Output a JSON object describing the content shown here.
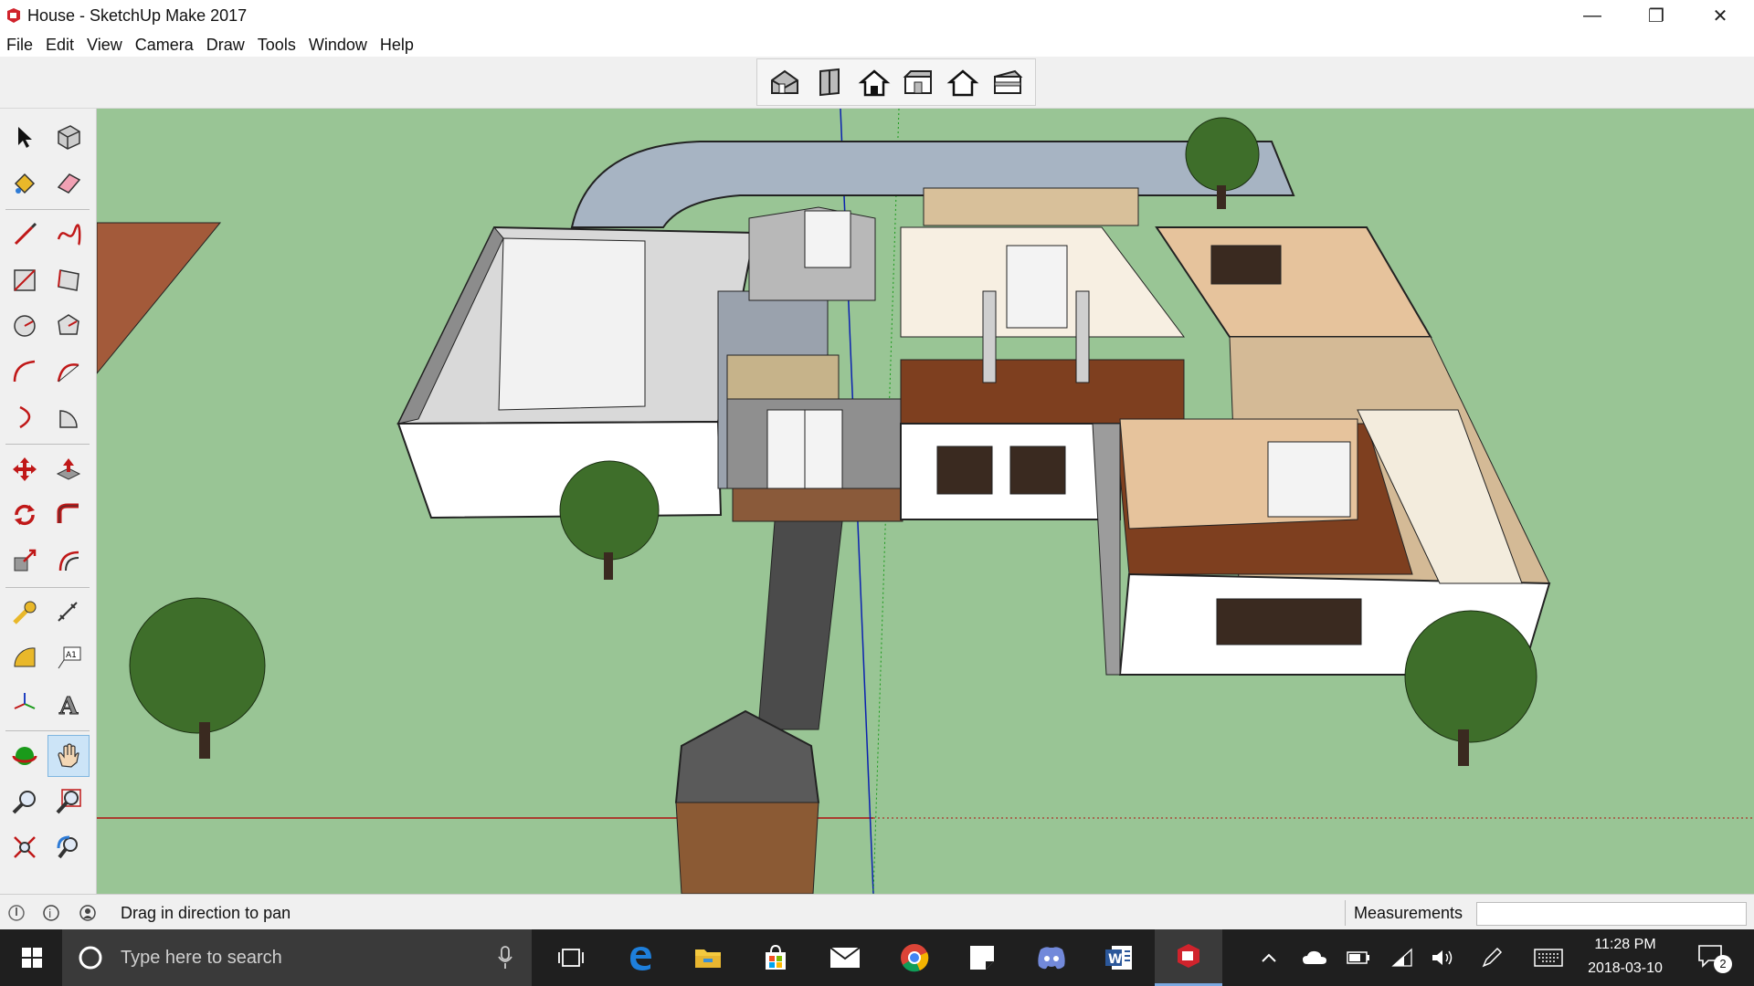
{
  "window": {
    "title": "House - SketchUp Make 2017",
    "minimize_glyph": "—",
    "restore_glyph": "❐",
    "close_glyph": "✕"
  },
  "menu": {
    "items": [
      {
        "label": "File"
      },
      {
        "label": "Edit"
      },
      {
        "label": "View"
      },
      {
        "label": "Camera"
      },
      {
        "label": "Draw"
      },
      {
        "label": "Tools"
      },
      {
        "label": "Window"
      },
      {
        "label": "Help"
      }
    ]
  },
  "views_toolbar": {
    "buttons": [
      "iso-view-icon",
      "top-view-icon",
      "front-view-icon",
      "right-view-icon",
      "back-view-icon",
      "left-view-icon"
    ]
  },
  "left_toolbar": {
    "tools": [
      "select-icon",
      "make-component-icon",
      "paint-bucket-icon",
      "eraser-icon",
      "line-icon",
      "freehand-icon",
      "rectangle-icon",
      "rotated-rectangle-icon",
      "circle-icon",
      "polygon-icon",
      "arc-icon",
      "two-point-arc-icon",
      "three-point-arc-icon",
      "pie-icon",
      "move-icon",
      "push-pull-icon",
      "rotate-icon",
      "follow-me-icon",
      "scale-icon",
      "offset-icon",
      "tape-measure-icon",
      "dimension-icon",
      "protractor-icon",
      "text-icon",
      "axes-icon",
      "3d-text-icon",
      "orbit-icon",
      "pan-icon",
      "zoom-icon",
      "zoom-window-icon",
      "zoom-extents-icon",
      "previous-view-icon"
    ],
    "active_tool": "pan-icon"
  },
  "status": {
    "message": "Drag in direction to pan",
    "measurements_label": "Measurements",
    "measurements_value": ""
  },
  "taskbar": {
    "search_placeholder": "Type here to search",
    "apps": [
      "task-view-icon",
      "edge-icon",
      "file-explorer-icon",
      "store-icon",
      "mail-icon",
      "chrome-icon",
      "sticky-notes-icon",
      "discord-icon",
      "word-icon",
      "sketchup-icon"
    ],
    "tray": [
      "chevron-up-icon",
      "onedrive-icon",
      "battery-icon",
      "wifi-icon",
      "volume-icon",
      "pen-icon",
      "keyboard-icon"
    ],
    "time": "11:28 PM",
    "date": "2018-03-10",
    "notification_count": "2"
  },
  "colors": {
    "ground": "#99c595",
    "sky": "#ffffff",
    "accent_active_tool": "#cce4f7",
    "taskbar": "#1f1f1f"
  }
}
